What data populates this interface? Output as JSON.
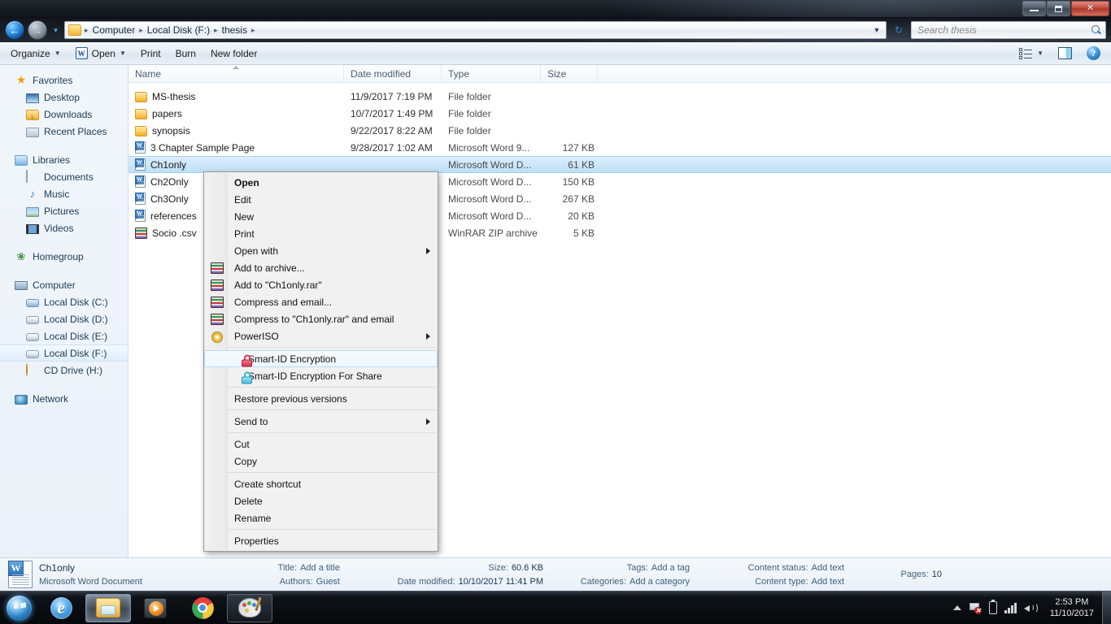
{
  "window": {
    "minimize_label": "Minimize",
    "maximize_label": "Maximize",
    "close_label": "Close"
  },
  "address": {
    "back_label": "◀",
    "forward_label": "▶",
    "recent_label": "▼",
    "crumbs": [
      "Computer",
      "Local Disk (F:)",
      "thesis"
    ],
    "separator": "▶",
    "dropdown_label": "▼",
    "refresh_label": "↻"
  },
  "search": {
    "placeholder": "Search thesis",
    "value": ""
  },
  "toolbar": {
    "organize_label": "Organize",
    "open_label": "Open",
    "open_icon_letter": "W",
    "print_label": "Print",
    "burn_label": "Burn",
    "new_folder_label": "New folder",
    "caret": "▼",
    "views_label": "Views",
    "preview_pane_label": "Preview pane",
    "help_label": "?"
  },
  "sidebar": {
    "groups": [
      {
        "header": {
          "label": "Favorites",
          "icon": "star-icon"
        },
        "items": [
          {
            "label": "Desktop",
            "icon": "desktop-icon"
          },
          {
            "label": "Downloads",
            "icon": "downloads-icon"
          },
          {
            "label": "Recent Places",
            "icon": "recent-places-icon"
          }
        ]
      },
      {
        "header": {
          "label": "Libraries",
          "icon": "libraries-icon"
        },
        "items": [
          {
            "label": "Documents",
            "icon": "documents-icon"
          },
          {
            "label": "Music",
            "icon": "music-icon"
          },
          {
            "label": "Pictures",
            "icon": "pictures-icon"
          },
          {
            "label": "Videos",
            "icon": "videos-icon"
          }
        ]
      },
      {
        "header": {
          "label": "Homegroup",
          "icon": "homegroup-icon"
        },
        "items": []
      },
      {
        "header": {
          "label": "Computer",
          "icon": "computer-icon"
        },
        "items": [
          {
            "label": "Local Disk (C:)",
            "icon": "system-drive-icon",
            "selected": false
          },
          {
            "label": "Local Disk (D:)",
            "icon": "drive-icon",
            "selected": false
          },
          {
            "label": "Local Disk (E:)",
            "icon": "drive-icon",
            "selected": false
          },
          {
            "label": "Local Disk (F:)",
            "icon": "drive-icon",
            "selected": true
          },
          {
            "label": "CD Drive (H:)",
            "icon": "cd-drive-icon",
            "selected": false
          }
        ]
      },
      {
        "header": {
          "label": "Network",
          "icon": "network-icon"
        },
        "items": []
      }
    ]
  },
  "file_list": {
    "columns": [
      {
        "key": "name",
        "label": "Name",
        "sorted": true
      },
      {
        "key": "date",
        "label": "Date modified",
        "sorted": false
      },
      {
        "key": "type",
        "label": "Type",
        "sorted": false
      },
      {
        "key": "size",
        "label": "Size",
        "sorted": false
      }
    ],
    "rows": [
      {
        "name": "MS-thesis",
        "date": "11/9/2017 7:19 PM",
        "type": "File folder",
        "size": "",
        "icon": "folder-icon",
        "selected": false
      },
      {
        "name": "papers",
        "date": "10/7/2017 1:49 PM",
        "type": "File folder",
        "size": "",
        "icon": "folder-icon",
        "selected": false
      },
      {
        "name": "synopsis",
        "date": "9/22/2017 8:22 AM",
        "type": "File folder",
        "size": "",
        "icon": "folder-icon",
        "selected": false
      },
      {
        "name": "3 Chapter Sample Page",
        "date": "9/28/2017 1:02 AM",
        "type": "Microsoft Word 9...",
        "size": "127 KB",
        "icon": "word-icon",
        "selected": false
      },
      {
        "name": "Ch1only",
        "date": "",
        "type": "Microsoft Word D...",
        "size": "61 KB",
        "icon": "word-icon",
        "selected": true
      },
      {
        "name": "Ch2Only",
        "date": "",
        "type": "Microsoft Word D...",
        "size": "150 KB",
        "icon": "word-icon",
        "selected": false
      },
      {
        "name": "Ch3Only",
        "date": "",
        "type": "Microsoft Word D...",
        "size": "267 KB",
        "icon": "word-icon",
        "selected": false
      },
      {
        "name": "references",
        "date": "",
        "type": "Microsoft Word D...",
        "size": "20 KB",
        "icon": "word-icon",
        "selected": false
      },
      {
        "name": "Socio .csv",
        "date": "",
        "type": "WinRAR ZIP archive",
        "size": "5 KB",
        "icon": "winrar-icon",
        "selected": false
      }
    ]
  },
  "context_menu": {
    "items": [
      {
        "label": "Open",
        "bold": true,
        "icon": null,
        "submenu": false,
        "highlight": false
      },
      {
        "label": "Edit",
        "bold": false,
        "icon": null,
        "submenu": false,
        "highlight": false
      },
      {
        "label": "New",
        "bold": false,
        "icon": null,
        "submenu": false,
        "highlight": false
      },
      {
        "label": "Print",
        "bold": false,
        "icon": null,
        "submenu": false,
        "highlight": false
      },
      {
        "label": "Open with",
        "bold": false,
        "icon": null,
        "submenu": true,
        "highlight": false
      },
      {
        "label": "Add to archive...",
        "bold": false,
        "icon": "winrar-icon",
        "submenu": false,
        "highlight": false
      },
      {
        "label": "Add to \"Ch1only.rar\"",
        "bold": false,
        "icon": "winrar-icon",
        "submenu": false,
        "highlight": false
      },
      {
        "label": "Compress and email...",
        "bold": false,
        "icon": "winrar-icon",
        "submenu": false,
        "highlight": false
      },
      {
        "label": "Compress to \"Ch1only.rar\" and email",
        "bold": false,
        "icon": "winrar-icon",
        "submenu": false,
        "highlight": false
      },
      {
        "label": "PowerISO",
        "bold": false,
        "icon": "poweriso-icon",
        "submenu": true,
        "highlight": false
      },
      {
        "separator": true
      },
      {
        "label": "Smart-ID Encryption",
        "bold": false,
        "icon": "lock-red-icon",
        "submenu": false,
        "highlight": true
      },
      {
        "label": "Smart-ID Encryption For Share",
        "bold": false,
        "icon": "lock-cyan-icon",
        "submenu": false,
        "highlight": false
      },
      {
        "separator": true
      },
      {
        "label": "Restore previous versions",
        "bold": false,
        "icon": null,
        "submenu": false,
        "highlight": false
      },
      {
        "separator": true
      },
      {
        "label": "Send to",
        "bold": false,
        "icon": null,
        "submenu": true,
        "highlight": false
      },
      {
        "separator": true
      },
      {
        "label": "Cut",
        "bold": false,
        "icon": null,
        "submenu": false,
        "highlight": false
      },
      {
        "label": "Copy",
        "bold": false,
        "icon": null,
        "submenu": false,
        "highlight": false
      },
      {
        "separator": true
      },
      {
        "label": "Create shortcut",
        "bold": false,
        "icon": null,
        "submenu": false,
        "highlight": false
      },
      {
        "label": "Delete",
        "bold": false,
        "icon": null,
        "submenu": false,
        "highlight": false
      },
      {
        "label": "Rename",
        "bold": false,
        "icon": null,
        "submenu": false,
        "highlight": false
      },
      {
        "separator": true
      },
      {
        "label": "Properties",
        "bold": false,
        "icon": null,
        "submenu": false,
        "highlight": false
      }
    ]
  },
  "details_pane": {
    "file_name": "Ch1only",
    "file_type": "Microsoft Word Document",
    "title_label": "Title:",
    "title_value": "Add a title",
    "authors_label": "Authors:",
    "authors_value": "Guest",
    "size_label": "Size:",
    "size_value": "60.6 KB",
    "date_modified_label": "Date modified:",
    "date_modified_value": "10/10/2017 11:41 PM",
    "tags_label": "Tags:",
    "tags_value": "Add a tag",
    "categories_label": "Categories:",
    "categories_value": "Add a category",
    "content_status_label": "Content status:",
    "content_status_value": "Add text",
    "content_type_label": "Content type:",
    "content_type_value": "Add text",
    "pages_label": "Pages:",
    "pages_value": "10"
  },
  "taskbar": {
    "start_label": "Start",
    "buttons": [
      {
        "name": "internet-explorer",
        "label": "Internet Explorer",
        "active": false,
        "pinned": false
      },
      {
        "name": "windows-explorer",
        "label": "Windows Explorer",
        "active": true,
        "pinned": false
      },
      {
        "name": "media-player",
        "label": "Windows Media Player",
        "active": false,
        "pinned": false
      },
      {
        "name": "google-chrome",
        "label": "Google Chrome",
        "active": false,
        "pinned": false
      },
      {
        "name": "paint",
        "label": "Paint",
        "active": false,
        "pinned": true
      }
    ],
    "tray": {
      "show_hidden_label": "Show hidden icons",
      "action_center_label": "Action Center",
      "battery_label": "Battery",
      "network_label": "Network",
      "volume_label": "Volume",
      "time": "2:53 PM",
      "date": "11/10/2017",
      "show_desktop_label": "Show desktop"
    }
  },
  "colors": {
    "selection": "#bfdff7",
    "accent": "#2a7fc4",
    "folder": "#fdcd5c",
    "word_blue": "#2c6fb5",
    "lock_red": "#d7364f",
    "lock_cyan": "#49bcdb"
  }
}
